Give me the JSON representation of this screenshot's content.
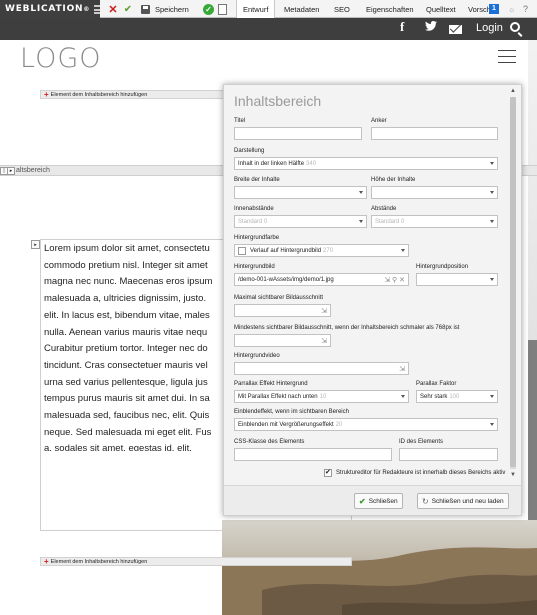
{
  "toolbar": {
    "brand": "WEBLICATION",
    "brand_mark": "®",
    "save_label": "Speichern",
    "tabs": [
      "Entwurf",
      "Metadaten",
      "SEO",
      "Eigenschaften",
      "Quelltext",
      "Vorschau"
    ],
    "badge": "1",
    "help": "?"
  },
  "site": {
    "login": "Login",
    "logo": "LOGO",
    "facebook": "f"
  },
  "page": {
    "add_element_label": "Element dem Inhaltsbereich hinzufügen",
    "section_label": "altsbereich",
    "lorem_lines": [
      "Lorem ipsum dolor sit amet, consectetu",
      "commodo pretium nisl. Integer sit amet",
      "magna nec nunc. Maecenas eros ipsum",
      "malesuada a, ultricies dignissim, justo.",
      "elit. In lacus est, bibendum vitae, males",
      "nulla. Aenean varius mauris vitae nequ",
      "Curabitur pretium tortor. Integer nec do",
      "tincidunt. Cras consectetuer mauris vel",
      "urna sed varius pellentesque, ligula jus",
      "tempus purus mauris sit amet dui. In sa",
      "malesuada sed, faucibus nec, elit. Quis",
      "neque. Sed malesuada mi eget elit. Fus",
      "a, sodales sit amet, egestas id, elit."
    ]
  },
  "panel": {
    "title": "Inhaltsbereich",
    "titel_label": "Titel",
    "anker_label": "Anker",
    "darstellung_label": "Darstellung",
    "darstellung_value": "Inhalt in der linken Hälfte",
    "darstellung_hint": "340",
    "breite_label": "Breite der Inhalte",
    "hoehe_label": "Höhe der Inhalte",
    "innenabstaende_label": "Innenabstände",
    "innenabstaende_value": "Standard 0",
    "abstaende_label": "Abstände",
    "abstaende_value": "Standard 0",
    "hintergrundfarbe_label": "Hintergrundfarbe",
    "verlauf_label": "Verlauf auf Hintergrundbild",
    "verlauf_hint": "270",
    "hintergrundbild_label": "Hintergrundbild",
    "hintergrundbild_value": "/demo-001-wAssets/img/demo/1.jpg",
    "hintergrundposition_label": "Hintergrundposition",
    "max_ausschnitt_label": "Maximal sichtbarer Bildausschnitt",
    "min_ausschnitt_label": "Mindestens sichtbarer Bildausschnitt, wenn der Inhaltsbereich schmaler als 768px ist",
    "video_label": "Hintergrundvideo",
    "parallax_label": "Parrallax Effekt Hintergrund",
    "parallax_value": "Mit Parallax Effekt nach unten",
    "parallax_hint": "10",
    "faktor_label": "Parallax Faktor",
    "faktor_value": "Sehr stark",
    "faktor_hint": "100",
    "einblend_label": "Einblendeffekt, wenn im sichtbaren Bereich",
    "einblend_value": "Einblenden mit Vergrößerungseffekt",
    "einblend_hint": "20",
    "css_label": "CSS-Klasse des Elements",
    "id_label": "ID des Elements",
    "struktur_label": "Struktureditor für Redakteure ist innerhalb dieses Bereichs aktiv",
    "close_label": "Schließen",
    "close_reload_label": "Schließen und neu laden"
  },
  "colors": {
    "toolbar_dark": "#3f3f3f",
    "site_header": "#3e3e3e",
    "accent_red": "#d01b1b",
    "accent_green": "#3a9c2a",
    "badge_blue": "#1a6fd8"
  }
}
